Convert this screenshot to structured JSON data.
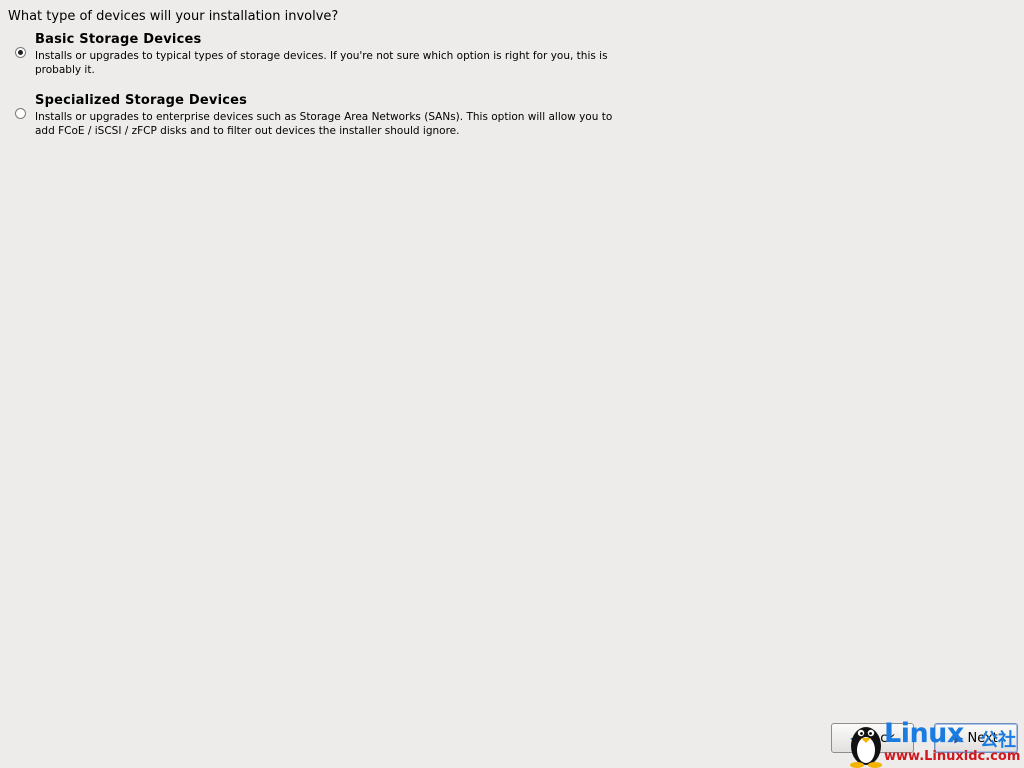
{
  "question": "What type of devices will your installation involve?",
  "options": [
    {
      "title": "Basic Storage Devices",
      "description": "Installs or upgrades to typical types of storage devices.  If you're not sure which option is right for you, this is probably it.",
      "selected": true
    },
    {
      "title": "Specialized Storage Devices",
      "description": "Installs or upgrades to enterprise devices such as Storage Area Networks (SANs). This option will allow you to add FCoE / iSCSI / zFCP disks and to filter out devices the installer should ignore.",
      "selected": false
    }
  ],
  "buttons": {
    "back_label": "Back",
    "next_label": "Next",
    "back_icon": "arrow-left-icon",
    "next_icon": "arrow-right-icon"
  },
  "watermark": {
    "brand": "Linux",
    "brand_cn": "公社",
    "url": "www.Linuxidc.com"
  },
  "colors": {
    "background": "#edecea",
    "accent": "#1a7be0",
    "url_red": "#d0191f"
  }
}
